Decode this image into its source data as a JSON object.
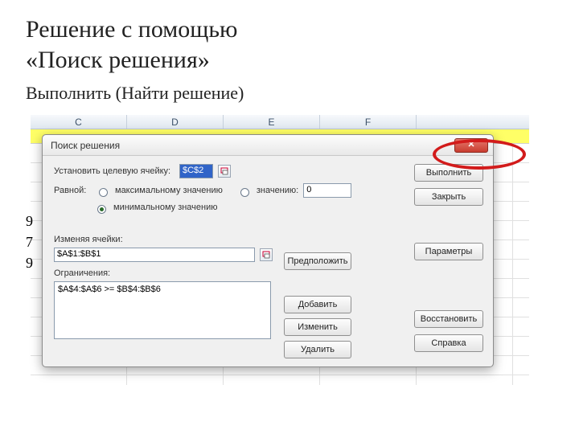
{
  "slide": {
    "title_line1": "Решение с помощью",
    "title_line2": "«Поиск решения»",
    "subtitle": "Выполнить (Найти решение)"
  },
  "sheet": {
    "columns": [
      "C",
      "D",
      "E",
      "F"
    ],
    "bg_values": [
      "9",
      "7",
      "9"
    ]
  },
  "dialog": {
    "title": "Поиск решения",
    "target_label": "Установить целевую ячейку:",
    "target_value": "$C$2",
    "equal_label": "Равной:",
    "opt_max": "максимальному значению",
    "opt_value": "значению:",
    "value_input": "0",
    "opt_min": "минимальному значению",
    "changing_label": "Изменяя ячейки:",
    "changing_value": "$A$1:$B$1",
    "constraints_label": "Ограничения:",
    "constraint_item": "$A$4:$A$6 >= $B$4:$B$6",
    "buttons": {
      "execute": "Выполнить",
      "close": "Закрыть",
      "guess": "Предположить",
      "params": "Параметры",
      "add": "Добавить",
      "edit": "Изменить",
      "delete": "Удалить",
      "restore": "Восстановить",
      "help": "Справка"
    }
  }
}
